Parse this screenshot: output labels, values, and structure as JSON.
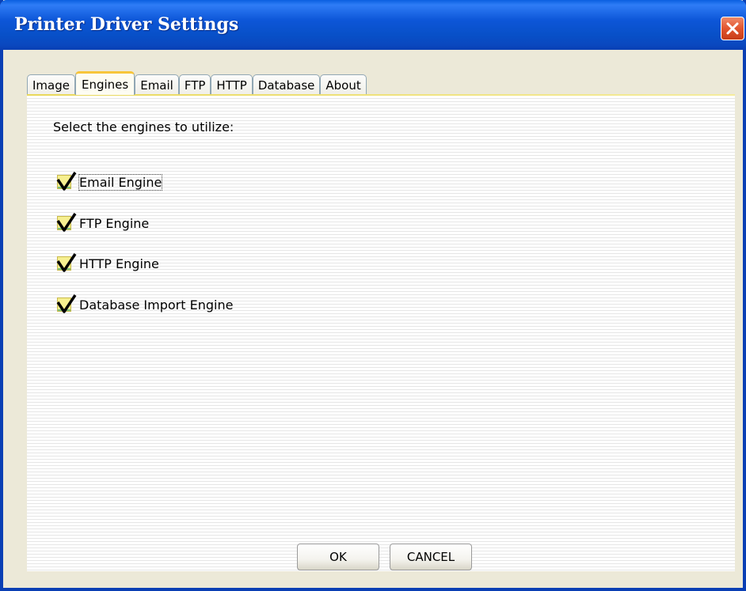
{
  "window": {
    "title": "Printer Driver Settings"
  },
  "tabs": [
    {
      "label": "Image",
      "active": false
    },
    {
      "label": "Engines",
      "active": true
    },
    {
      "label": "Email",
      "active": false
    },
    {
      "label": "FTP",
      "active": false
    },
    {
      "label": "HTTP",
      "active": false
    },
    {
      "label": "Database",
      "active": false
    },
    {
      "label": "About",
      "active": false
    }
  ],
  "engines": {
    "prompt": "Select the engines to utilize:",
    "options": [
      {
        "label": "Email Engine",
        "checked": true
      },
      {
        "label": "FTP Engine",
        "checked": true
      },
      {
        "label": "HTTP Engine",
        "checked": true
      },
      {
        "label": "Database Import Engine",
        "checked": true
      }
    ]
  },
  "buttons": {
    "ok": "OK",
    "cancel": "CANCEL"
  },
  "colors": {
    "titlebar": "#0a5fe0",
    "window_bg": "#ece9d8",
    "active_tab_accent": "#f7c53a",
    "close_button": "#e2552e",
    "check_box_fill": "#f6ef90"
  }
}
